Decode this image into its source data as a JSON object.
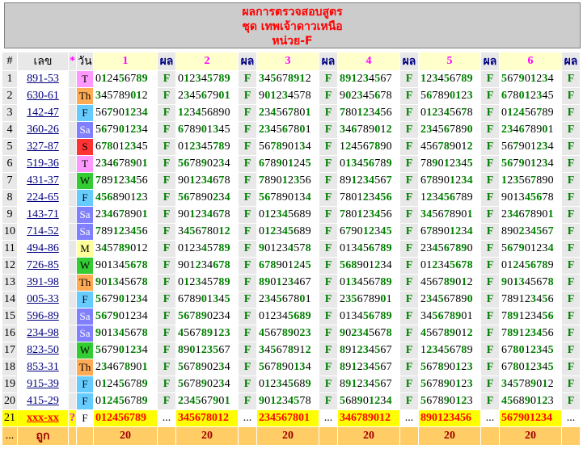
{
  "header": {
    "line1": "ผลการตรวจสอบสูตร",
    "line2": "ชุด เทพเจ้าดาวเหนือ",
    "line3": "หน่วย-F"
  },
  "table": {
    "columns": {
      "hash": "#",
      "lek": "เลข",
      "star": "*",
      "day": "วัน",
      "set_labels": [
        "1",
        "2",
        "3",
        "4",
        "5",
        "6"
      ],
      "result": "ผล"
    },
    "rows": [
      {
        "n": "1",
        "lek": "891-53",
        "day": "T",
        "sets": [
          "012456789",
          "012345789",
          "345678912",
          "891234567",
          "123456789",
          "567901234"
        ],
        "res": [
          "F",
          "F",
          "F",
          "F",
          "F",
          "F"
        ]
      },
      {
        "n": "2",
        "lek": "630-61",
        "day": "Th",
        "sets": [
          "345789012",
          "234567901",
          "901234578",
          "902345678",
          "567890123",
          "678012345"
        ],
        "res": [
          "F",
          "F",
          "F",
          "F",
          "F",
          "F"
        ]
      },
      {
        "n": "3",
        "lek": "142-47",
        "day": "F",
        "sets": [
          "567901234",
          "123456890",
          "234567801",
          "780123456",
          "012345678",
          "012456789"
        ],
        "res": [
          "F",
          "F",
          "F",
          "F",
          "F",
          "F"
        ]
      },
      {
        "n": "4",
        "lek": "360-26",
        "day": "Sa",
        "sets": [
          "567901234",
          "678901345",
          "234567801",
          "346789012",
          "234567890",
          "234678901"
        ],
        "res": [
          "F",
          "F",
          "F",
          "F",
          "F",
          "F"
        ]
      },
      {
        "n": "5",
        "lek": "327-87",
        "day": "S",
        "sets": [
          "678012345",
          "012345789",
          "567890134",
          "124567890",
          "456789012",
          "567901234"
        ],
        "res": [
          "F",
          "F",
          "F",
          "F",
          "F",
          "F"
        ]
      },
      {
        "n": "6",
        "lek": "519-36",
        "day": "T",
        "sets": [
          "234678901",
          "567890234",
          "678901245",
          "013456789",
          "789012345",
          "567901234"
        ],
        "res": [
          "F",
          "F",
          "F",
          "F",
          "F",
          "F"
        ]
      },
      {
        "n": "7",
        "lek": "431-37",
        "day": "W",
        "sets": [
          "789123456",
          "901234678",
          "789012356",
          "891234567",
          "678901234",
          "123567890"
        ],
        "res": [
          "F",
          "F",
          "F",
          "F",
          "F",
          "F"
        ]
      },
      {
        "n": "8",
        "lek": "224-65",
        "day": "F",
        "sets": [
          "456890123",
          "567890234",
          "567890134",
          "780123456",
          "123456789",
          "901345678"
        ],
        "res": [
          "F",
          "F",
          "F",
          "F",
          "F",
          "F"
        ]
      },
      {
        "n": "9",
        "lek": "143-71",
        "day": "Sa",
        "sets": [
          "234678901",
          "901234678",
          "012345689",
          "780123456",
          "345678901",
          "234678901"
        ],
        "res": [
          "F",
          "F",
          "F",
          "F",
          "F",
          "F"
        ]
      },
      {
        "n": "10",
        "lek": "714-52",
        "day": "Sa",
        "sets": [
          "789123456",
          "345678012",
          "012345689",
          "679012345",
          "678901234",
          "890234567"
        ],
        "res": [
          "F",
          "F",
          "F",
          "F",
          "F",
          "F"
        ]
      },
      {
        "n": "11",
        "lek": "494-86",
        "day": "M",
        "sets": [
          "345789012",
          "012345789",
          "901234578",
          "013456789",
          "234567890",
          "567901234"
        ],
        "res": [
          "F",
          "F",
          "F",
          "F",
          "F",
          "F"
        ]
      },
      {
        "n": "12",
        "lek": "726-85",
        "day": "W",
        "sets": [
          "901345678",
          "901234678",
          "678901245",
          "568901234",
          "012345678",
          "012456789"
        ],
        "res": [
          "F",
          "F",
          "F",
          "F",
          "F",
          "F"
        ]
      },
      {
        "n": "13",
        "lek": "391-98",
        "day": "Th",
        "sets": [
          "901345678",
          "012345789",
          "890123467",
          "013456789",
          "456789012",
          "901345678"
        ],
        "res": [
          "F",
          "F",
          "F",
          "F",
          "F",
          "F"
        ]
      },
      {
        "n": "14",
        "lek": "005-33",
        "day": "F",
        "sets": [
          "567901234",
          "678901345",
          "234567801",
          "235678901",
          "234567890",
          "789123456"
        ],
        "res": [
          "F",
          "F",
          "F",
          "F",
          "F",
          "F"
        ]
      },
      {
        "n": "15",
        "lek": "596-89",
        "day": "Sa",
        "sets": [
          "567901234",
          "567890234",
          "012345689",
          "013456789",
          "345678901",
          "789123456"
        ],
        "res": [
          "F",
          "F",
          "F",
          "F",
          "F",
          "F"
        ]
      },
      {
        "n": "16",
        "lek": "234-98",
        "day": "Sa",
        "sets": [
          "901345678",
          "456789123",
          "456789023",
          "902345678",
          "456789012",
          "789123456"
        ],
        "res": [
          "F",
          "F",
          "F",
          "F",
          "F",
          "F"
        ]
      },
      {
        "n": "17",
        "lek": "823-50",
        "day": "W",
        "sets": [
          "567901234",
          "890123567",
          "345678912",
          "891234567",
          "123456789",
          "678012345"
        ],
        "res": [
          "F",
          "F",
          "F",
          "F",
          "F",
          "F"
        ]
      },
      {
        "n": "18",
        "lek": "853-31",
        "day": "Th",
        "sets": [
          "234678901",
          "567890234",
          "567890134",
          "891234567",
          "567890123",
          "678012345"
        ],
        "res": [
          "F",
          "F",
          "F",
          "F",
          "F",
          "F"
        ]
      },
      {
        "n": "19",
        "lek": "915-39",
        "day": "F",
        "sets": [
          "012456789",
          "567890234",
          "012345689",
          "891234567",
          "567890123",
          "345789012"
        ],
        "res": [
          "F",
          "F",
          "F",
          "F",
          "F",
          "F"
        ]
      },
      {
        "n": "20",
        "lek": "415-29",
        "day": "F",
        "sets": [
          "012456789",
          "234567901",
          "901234578",
          "568901234",
          "567890123",
          "456890123"
        ],
        "res": [
          "F",
          "F",
          "F",
          "F",
          "F",
          "F"
        ]
      }
    ],
    "prediction_row": {
      "n": "21",
      "lek": "xxx-xx",
      "star": "?",
      "day": "F",
      "sets": [
        "012456789",
        "345678012",
        "234567801",
        "346789012",
        "890123456",
        "567901234"
      ],
      "res": [
        "...",
        "...",
        "...",
        "...",
        "...",
        "..."
      ]
    },
    "total_row": {
      "n": "...",
      "label": "ถูก",
      "counts": [
        "20",
        "20",
        "20",
        "20",
        "20",
        "20"
      ]
    }
  },
  "colors": {
    "header_text": "#ff0000",
    "header_bg": "#cccccc",
    "result_green": "#008000",
    "prediction_bg": "#ffff00",
    "total_bg": "#ffcc66"
  }
}
